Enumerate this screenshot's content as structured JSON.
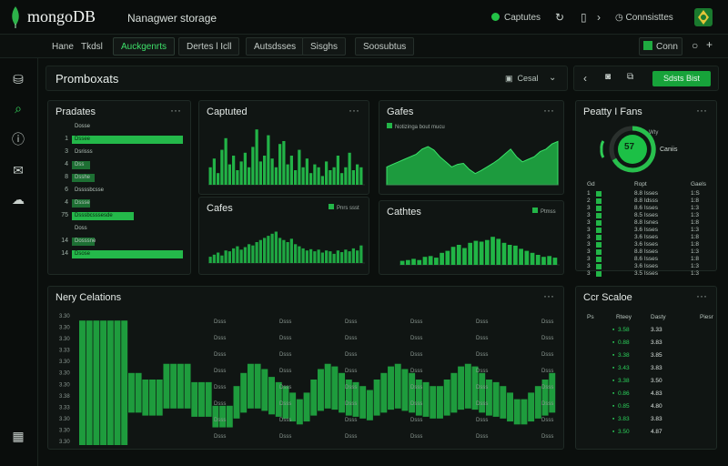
{
  "app": {
    "logo": "mongoDB",
    "project": "Nanagwer storage"
  },
  "topbar": {
    "status": "Captutes",
    "connections": "Connsisttes",
    "connect_label": "Conn"
  },
  "tabs": [
    {
      "label": "Hane",
      "active": false
    },
    {
      "label": "Tkdsl",
      "active": false
    },
    {
      "label": "Auckgenrts",
      "active": true
    },
    {
      "label": "Dertes l Icll",
      "active": false
    },
    {
      "label": "Autsdsses",
      "active": false
    },
    {
      "label": "Sisghs",
      "active": false
    },
    {
      "label": "Soosubtus",
      "active": false
    }
  ],
  "header": {
    "title": "Promboxats",
    "control_label": "Cesal",
    "action_button": "Sdsts Bist"
  },
  "panels": {
    "products": {
      "title": "Pradates"
    },
    "captured": {
      "title": "Captuted"
    },
    "sales_top": {
      "title": "Gafes",
      "legend": "Notizinga bout mucu"
    },
    "sales_bottom": {
      "title": "Cafes",
      "legend": "Pnrs ssst"
    },
    "contents": {
      "title": "Cathtes",
      "legend": "Ptmss"
    },
    "priority": {
      "title": "Peatty I Fans",
      "gauge_value": "57",
      "gauge_label_top": "Wty",
      "gauge_label_right": "Caniis"
    },
    "nav_details": {
      "title": "Nery Celations"
    },
    "car_stats": {
      "title": "Ccr Scaloe"
    }
  },
  "product_list": [
    {
      "num": "",
      "label": "Dosse",
      "value": 0
    },
    {
      "num": "1",
      "label": "Dssee",
      "value": 0.98
    },
    {
      "num": "3",
      "label": "Dsrisss",
      "value": 0
    },
    {
      "num": "4",
      "label": "Dss",
      "value": 0.12
    },
    {
      "num": "8",
      "label": "Dsshe",
      "value": 0.2
    },
    {
      "num": "6",
      "label": "Dssssbcsse",
      "value": 0
    },
    {
      "num": "4",
      "label": "Dssse",
      "value": 0.15
    },
    {
      "num": "75",
      "label": "Dsssbcsssesde",
      "value": 0.55
    },
    {
      "num": "",
      "label": "Doss",
      "value": 0
    },
    {
      "num": "14",
      "label": "Dosssne",
      "value": 0.2
    },
    {
      "num": "14",
      "label": "Dsose",
      "value": 0.98
    }
  ],
  "priority_table": {
    "headers": [
      "Gd",
      "Ropt",
      "Gaels"
    ],
    "rows": [
      [
        "1",
        "8.8 Isses",
        "1:S"
      ],
      [
        "2",
        "8.8 Idsss",
        "1:8"
      ],
      [
        "3",
        "8.6 Isses",
        "1:3"
      ],
      [
        "3",
        "8.5 Isses",
        "1:3"
      ],
      [
        "3",
        "8.8 Isnes",
        "1:8"
      ],
      [
        "3",
        "3.6 Isses",
        "1:3"
      ],
      [
        "3",
        "3.6 Isses",
        "1:8"
      ],
      [
        "3",
        "3.6 Isses",
        "1:8"
      ],
      [
        "3",
        "8.8 Isses",
        "1:3"
      ],
      [
        "3",
        "8.6 Isses",
        "1:8"
      ],
      [
        "3",
        "3.6 Isses",
        "1:3"
      ],
      [
        "3",
        "3.5 Isses",
        "1:3"
      ]
    ]
  },
  "car_table": {
    "headers": [
      "Ps",
      "Rteey",
      "Dasty",
      "Piesr"
    ],
    "rows": [
      [
        "3.58",
        "3.33"
      ],
      [
        "0.88",
        "3.83"
      ],
      [
        "3.38",
        "3.85"
      ],
      [
        "3.43",
        "3.83"
      ],
      [
        "3.38",
        "3.50"
      ],
      [
        "0.86",
        "4.83"
      ],
      [
        "0.85",
        "4.80"
      ],
      [
        "3.83",
        "3.83"
      ],
      [
        "3.50",
        "4.87"
      ]
    ]
  },
  "nav_chart": {
    "yticks": [
      "3.30",
      "3.30",
      "3.30",
      "3.33",
      "3.30",
      "3.30",
      "3.30",
      "3.38",
      "3.33",
      "3.30",
      "3.30",
      "3.30"
    ],
    "col_labels": [
      "Dsss",
      "Dsss",
      "Dsss",
      "Dsss",
      "Dsss",
      "Dsss",
      "Dsss"
    ]
  },
  "chart_data": [
    {
      "type": "bar",
      "title": "Captuted",
      "values": [
        0.3,
        0.45,
        0.2,
        0.6,
        0.8,
        0.35,
        0.5,
        0.25,
        0.4,
        0.55,
        0.3,
        0.65,
        0.95,
        0.4,
        0.5,
        0.85,
        0.45,
        0.3,
        0.7,
        0.75,
        0.35,
        0.5,
        0.25,
        0.6,
        0.3,
        0.45,
        0.2,
        0.35,
        0.3,
        0.15,
        0.4,
        0.25,
        0.3,
        0.5,
        0.2,
        0.3,
        0.55,
        0.25,
        0.35,
        0.3
      ]
    },
    {
      "type": "area",
      "title": "Gafes",
      "values": [
        0.35,
        0.4,
        0.45,
        0.5,
        0.55,
        0.6,
        0.7,
        0.75,
        0.68,
        0.55,
        0.45,
        0.35,
        0.4,
        0.42,
        0.3,
        0.22,
        0.28,
        0.35,
        0.42,
        0.5,
        0.6,
        0.7,
        0.55,
        0.45,
        0.5,
        0.55,
        0.65,
        0.7,
        0.8,
        0.85
      ]
    },
    {
      "type": "bar",
      "title": "Cafes",
      "values": [
        0.15,
        0.2,
        0.25,
        0.18,
        0.3,
        0.28,
        0.35,
        0.4,
        0.32,
        0.38,
        0.45,
        0.42,
        0.5,
        0.55,
        0.6,
        0.65,
        0.7,
        0.75,
        0.6,
        0.55,
        0.5,
        0.58,
        0.45,
        0.4,
        0.35,
        0.3,
        0.33,
        0.28,
        0.32,
        0.25,
        0.3,
        0.28,
        0.22,
        0.3,
        0.26,
        0.32,
        0.28,
        0.35,
        0.3,
        0.42
      ]
    },
    {
      "type": "bar",
      "title": "Cathtes",
      "values": [
        0.1,
        0.12,
        0.15,
        0.12,
        0.2,
        0.22,
        0.18,
        0.3,
        0.35,
        0.45,
        0.5,
        0.42,
        0.55,
        0.6,
        0.58,
        0.62,
        0.7,
        0.65,
        0.55,
        0.5,
        0.48,
        0.4,
        0.35,
        0.3,
        0.25,
        0.2,
        0.22,
        0.18
      ]
    },
    {
      "type": "bar",
      "title": "Nery Celations",
      "values": [
        0.95,
        0.95,
        0.95,
        0.95,
        0.95,
        0.95,
        0.95,
        0.55,
        0.55,
        0.5,
        0.5,
        0.5,
        0.62,
        0.62,
        0.62,
        0.62,
        0.48,
        0.48,
        0.48,
        0.3,
        0.3,
        0.3,
        0.45,
        0.55,
        0.62,
        0.62,
        0.58,
        0.52,
        0.48,
        0.45,
        0.4,
        0.35,
        0.4,
        0.5,
        0.58,
        0.62,
        0.6,
        0.55,
        0.5,
        0.48,
        0.45,
        0.42,
        0.5,
        0.55,
        0.6,
        0.62,
        0.58,
        0.55,
        0.5,
        0.48,
        0.45,
        0.45,
        0.5,
        0.55,
        0.6,
        0.62,
        0.6,
        0.55,
        0.5,
        0.48,
        0.45,
        0.4,
        0.35,
        0.35,
        0.4,
        0.45,
        0.5,
        0.55
      ]
    }
  ]
}
